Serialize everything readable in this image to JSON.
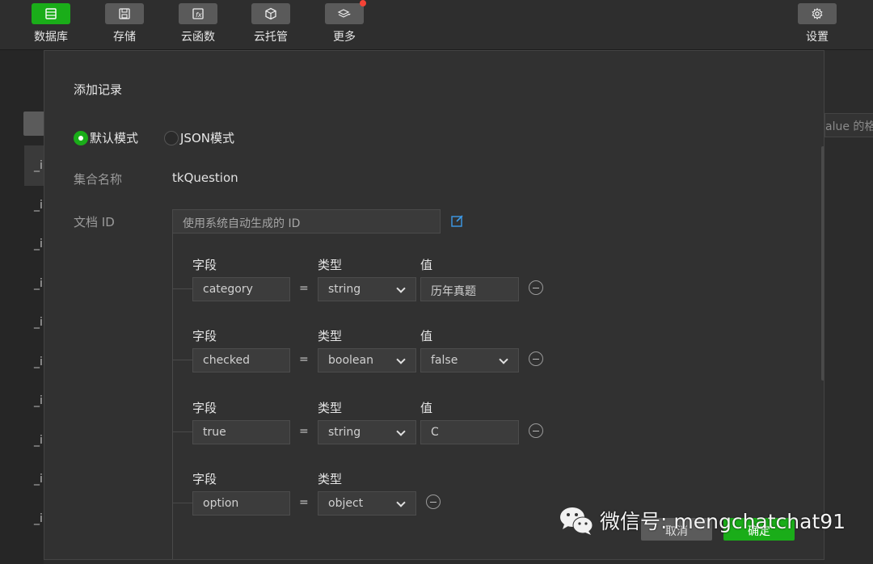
{
  "toolbar": {
    "items": [
      {
        "label": "数据库",
        "icon": "database-icon",
        "active": true
      },
      {
        "label": "存储",
        "icon": "floppy-icon"
      },
      {
        "label": "云函数",
        "icon": "function-icon"
      },
      {
        "label": "云托管",
        "icon": "cube-icon"
      },
      {
        "label": "更多",
        "icon": "layers-icon",
        "badge": true
      },
      {
        "label": "设置",
        "icon": "gear-icon"
      }
    ]
  },
  "background": {
    "row_prefix": "_i",
    "right_input_text": "alue 的格"
  },
  "modal": {
    "title": "添加记录",
    "modes": [
      {
        "label": "默认模式",
        "selected": true
      },
      {
        "label": "JSON模式",
        "selected": false
      }
    ],
    "collection_label": "集合名称",
    "collection_value": "tkQuestion",
    "docid_label": "文档 ID",
    "docid_placeholder": "使用系统自动生成的 ID",
    "headers": {
      "field": "字段",
      "type": "类型",
      "value": "值"
    },
    "equals": "=",
    "fields": [
      {
        "name": "category",
        "type": "string",
        "value": "历年真题"
      },
      {
        "name": "checked",
        "type": "boolean",
        "value": "false"
      },
      {
        "name": "true",
        "type": "string",
        "value": "C"
      },
      {
        "name": "option",
        "type": "object"
      }
    ],
    "cancel_label": "取消",
    "ok_label": "确定"
  },
  "watermark": {
    "text": "微信号: mengchatchat91"
  },
  "colors": {
    "accent": "#1aad19",
    "badge": "#f44336",
    "modal_bg": "#313131"
  }
}
